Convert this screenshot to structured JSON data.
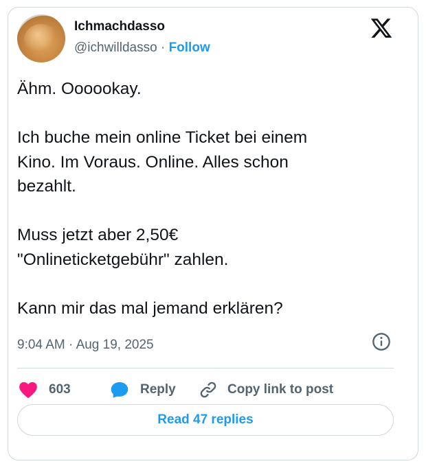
{
  "author": {
    "name": "Ichmachdasso",
    "handle": "@ichwilldasso",
    "separator": "·",
    "follow_label": "Follow",
    "avatar_icon": "avatar-image"
  },
  "tweet": {
    "lines": [
      "Ähm. Oooookay.",
      "",
      "Ich buche mein online Ticket bei einem",
      "Kino. Im Voraus. Online. Alles schon",
      "bezahlt.",
      "",
      "Muss jetzt aber 2,50€",
      "\"Onlineticketgebühr\" zahlen.",
      "",
      "Kann mir das mal jemand erklären?"
    ],
    "time": "9:04 AM",
    "separator": "·",
    "date": "Aug 19, 2025"
  },
  "actions": {
    "like_count": "603",
    "reply_label": "Reply",
    "copy_label": "Copy link to post",
    "like_color": "#f91880",
    "reply_color": "#1d9bf0"
  },
  "read_replies_label": "Read 47 replies",
  "colors": {
    "link": "#1d9bf0",
    "text": "#0f1419",
    "muted": "#536471",
    "border": "#cfd9de"
  }
}
